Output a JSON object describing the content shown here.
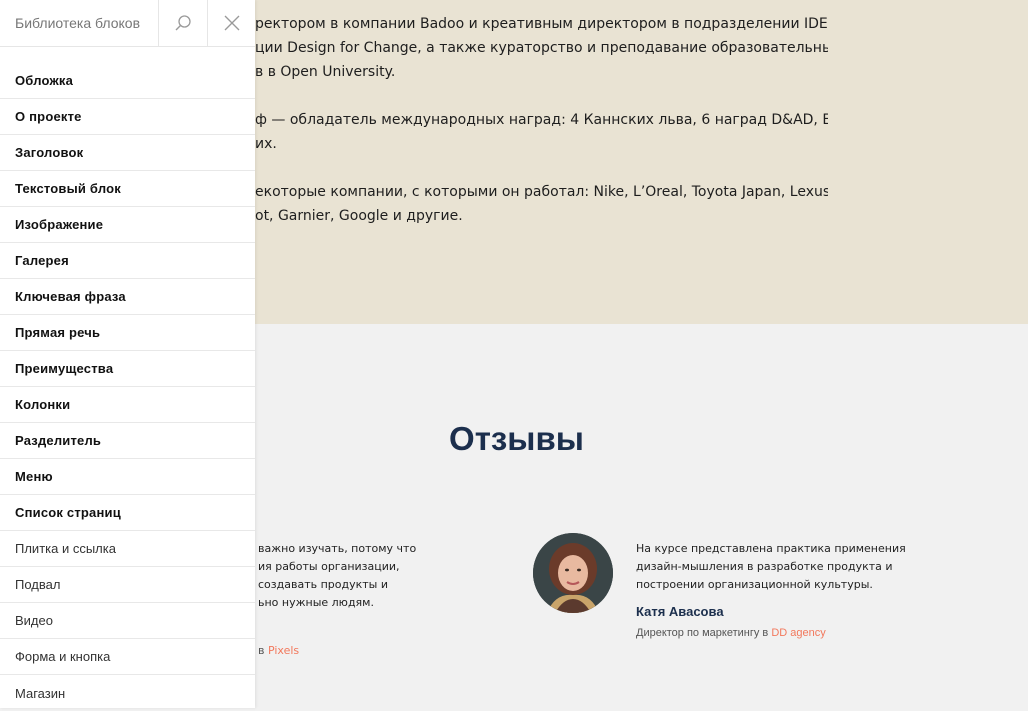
{
  "hero": {
    "lines": [
      "ректором в компании Badoo и креативным директором в подразделении IDEO",
      "ции Design for Change, а также кураторство и преподавание образовательных",
      "в в Open University."
    ],
    "lines2": [
      "ф — обладатель международных наград: 4 Каннских льва, 6 наград D&AD, Epica",
      "их."
    ],
    "lines3": [
      "екоторые компании, с которыми он работал: Nike, L’Oreal, Toyota Japan, Lexus,",
      "ot, Garnier, Google и другие."
    ]
  },
  "reviews": {
    "title": "Отзывы",
    "left": {
      "lines": [
        "важно изучать, потому что",
        "ия работы организации,",
        "создавать продукты и",
        "ьно нужные людям."
      ],
      "role_prefix": "в ",
      "company": "Pixels"
    },
    "right": {
      "lines": [
        "На курсе представлена практика применения",
        "дизайн-мышления в разработке продукта и",
        "построении организационной культуры."
      ],
      "name": "Катя Авасова",
      "role_prefix": "Директор по маркетингу в ",
      "company": "DD agency"
    }
  },
  "panel": {
    "search_placeholder": "Библиотека блоков",
    "items": [
      "Обложка",
      "О проекте",
      "Заголовок",
      "Текстовый блок",
      "Изображение",
      "Галерея",
      "Ключевая фраза",
      "Прямая речь",
      "Преимущества",
      "Колонки",
      "Разделитель",
      "Меню",
      "Список страниц",
      "Плитка и ссылка",
      "Подвал",
      "Видео",
      "Форма и кнопка",
      "Магазин"
    ]
  },
  "colors": {
    "hero_bg": "#e9e3d3",
    "page_bg": "#f1f1f1",
    "title": "#1c2f4d",
    "accent": "#f2785c"
  }
}
